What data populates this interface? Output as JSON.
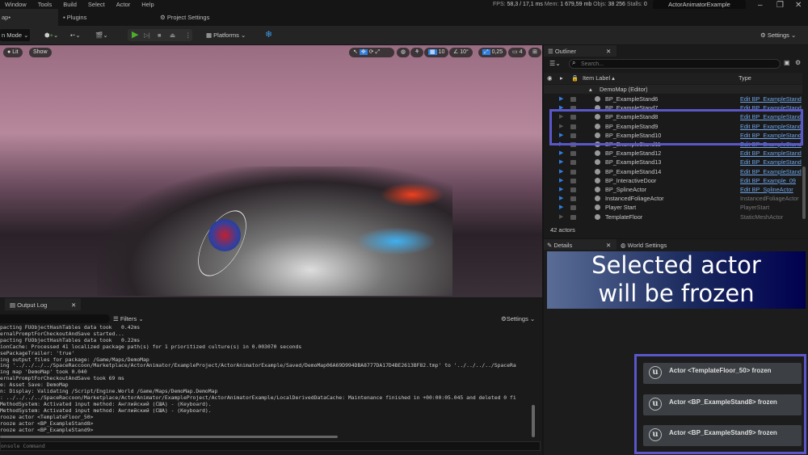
{
  "menu": [
    "Window",
    "Tools",
    "Build",
    "Select",
    "Actor",
    "Help"
  ],
  "stats": {
    "fps_label": "FPS:",
    "fps": "58,3",
    "ms": "/ 17,1 ms",
    "mem_label": "Mem:",
    "mem": "1 679,59 mb",
    "objs_label": "Objs:",
    "objs": "38 256",
    "stalls_label": "Stalls:",
    "stalls": "0"
  },
  "project_name": "ActorAnimatorExample",
  "tabs": {
    "map": "ap•",
    "plugins": "Plugins",
    "project_settings": "Project Settings"
  },
  "toolbar": {
    "mode": "n Mode",
    "platforms": "Platforms",
    "settings": "Settings"
  },
  "viewport": {
    "lit": "Lit",
    "show": "Show",
    "grid_snap": "10",
    "rot_snap": "10°",
    "scale_snap": "0,25",
    "cam_speed": "4"
  },
  "outliner": {
    "title": "Outliner",
    "search_placeholder": "Search...",
    "col_label": "Item Label ▴",
    "col_type": "Type",
    "root": "DemoMap (Editor)",
    "count": "42 actors",
    "rows": [
      {
        "label": "BP_ExampleStand6",
        "type": "Edit BP_ExampleStand",
        "link": true
      },
      {
        "label": "BP_ExampleStand7",
        "type": "Edit BP_ExampleStand",
        "link": true
      },
      {
        "label": "BP_ExampleStand8",
        "type": "Edit BP_ExampleStand",
        "link": true
      },
      {
        "label": "BP_ExampleStand9",
        "type": "Edit BP_ExampleStand",
        "link": true
      },
      {
        "label": "BP_ExampleStand10",
        "type": "Edit BP_ExampleStand",
        "link": true
      },
      {
        "label": "BP_ExampleStand11",
        "type": "Edit BP_ExampleStand",
        "link": true
      },
      {
        "label": "BP_ExampleStand12",
        "type": "Edit BP_ExampleStand",
        "link": true
      },
      {
        "label": "BP_ExampleStand13",
        "type": "Edit BP_ExampleStand",
        "link": true
      },
      {
        "label": "BP_ExampleStand14",
        "type": "Edit BP_ExampleStand",
        "link": true
      },
      {
        "label": "BP_InteractiveDoor",
        "type": "Edit BP_Example_09",
        "link": true
      },
      {
        "label": "BP_SplineActor",
        "type": "Edit BP_SplineActor",
        "link": true
      },
      {
        "label": "InstancedFoliageActor",
        "type": "InstancedFoliageActor",
        "link": false
      },
      {
        "label": "Player Start",
        "type": "PlayerStart",
        "link": false
      },
      {
        "label": "TemplateFloor",
        "type": "StaticMeshActor",
        "link": false
      }
    ]
  },
  "details": {
    "tab": "Details",
    "world_settings": "World Settings",
    "banner_line1": "Selected actor",
    "banner_line2": "will be frozen"
  },
  "notifications": [
    "Actor <TemplateFloor_50> frozen",
    "Actor <BP_ExampleStand8> frozen",
    "Actor <BP_ExampleStand9> frozen"
  ],
  "output_log": {
    "title": "Output Log",
    "filters": "Filters",
    "settings": "Settings",
    "console_placeholder": "onsole Command",
    "lines": [
      "pacting FUObjectHashTables data took   0.42ms",
      "ernalPromptForCheckoutAndSave started...",
      "pacting FUObjectHashTables data took   0.22ms",
      "ionCache: Processed 41 localized package path(s) for 1 prioritized culture(s) in 0.003070 seconds",
      "sePackageTrailer: 'true'",
      "ing output files for package: /Game/Maps/DemoMap",
      "ing '../../../../SpaceRaccoon/Marketplace/ActorAnimator/ExampleProject/ActorAnimatorExample/Saved/DemoMap06A69D994DBA8777DA17D4BE2613BF82.tmp' to '../../../../SpaceRa",
      "ing map 'DemoMap' took 0.040",
      "ernalPromptForCheckoutAndSave took 69 ms",
      "e: Asset Save: DemoMap",
      "n: Display: Validating /Script/Engine.World /Game/Maps/DemoMap.DemoMap",
      ": ../../../../SpaceRaccoon/Marketplace/ActorAnimator/ExampleProject/ActorAnimatorExample/LocalDerivedDataCache: Maintenance finished in +00:00:05.045 and deleted 0 fi",
      "MethodSystem: Activated input method: Английский (США) - (Keyboard).",
      "MethodSystem: Activated input method: Английский (США) - (Keyboard).",
      "rooze actor <TemplateFloor_50>",
      "rooze actor <BP_ExampleStand8>",
      "rooze actor <BP_ExampleStand9>"
    ]
  },
  "colors": {
    "accent": "#5b57c9",
    "link": "#6ea3e6",
    "play": "#4caf2a"
  }
}
